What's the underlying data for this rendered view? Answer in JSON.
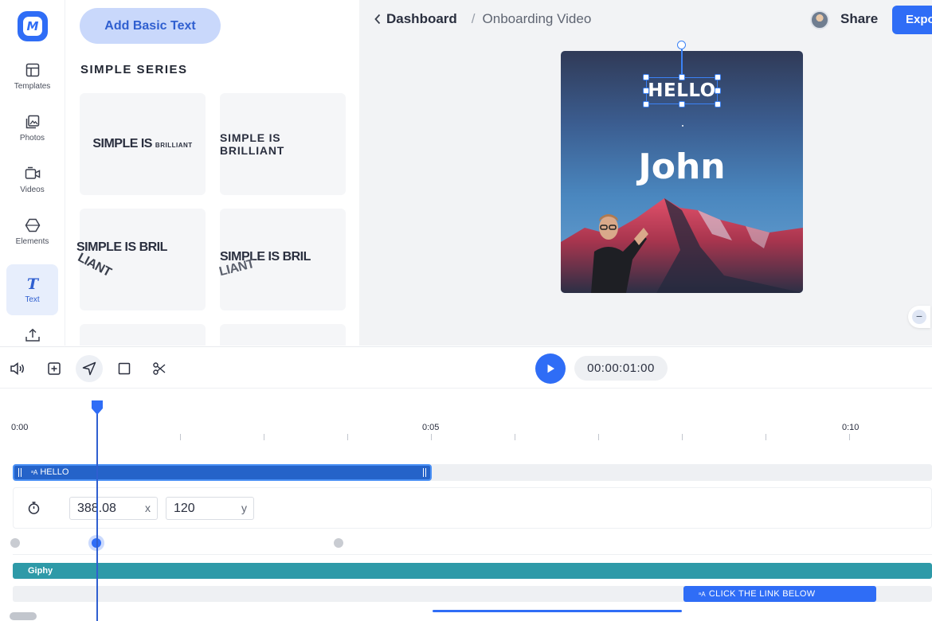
{
  "brand": {
    "logo_letter": "M",
    "accent": "#2f6df6"
  },
  "sidebar": {
    "items": [
      {
        "label": "Templates",
        "icon": "templates-icon"
      },
      {
        "label": "Photos",
        "icon": "photos-icon"
      },
      {
        "label": "Videos",
        "icon": "videos-icon"
      },
      {
        "label": "Elements",
        "icon": "elements-icon"
      },
      {
        "label": "Text",
        "icon": "text-icon",
        "active": true
      },
      {
        "label": "",
        "icon": "upload-icon"
      }
    ]
  },
  "panel": {
    "add_button": "Add Basic Text",
    "section_title": "SIMPLE SERIES",
    "presets": [
      {
        "line1": "SIMPLE IS",
        "line2": "BRILLIANT"
      },
      {
        "text": "SIMPLE IS BRILLIANT"
      },
      {
        "line1": "SIMPLE IS BRIL",
        "line2": "LIANT"
      },
      {
        "line1": "SIMPLE IS BRIL",
        "line2": "LIANT"
      }
    ]
  },
  "header": {
    "back_label": "Dashboard",
    "separator": "/",
    "project_title": "Onboarding Video",
    "share_label": "Share",
    "export_label": "Expo"
  },
  "canvas": {
    "selected_text": "HELLO",
    "headline": "John"
  },
  "toolbar": {
    "timecode": "00:00:01:00"
  },
  "timeline": {
    "tick_labels": [
      "0:00",
      "0:05",
      "0:10"
    ],
    "clips": {
      "hello": "HELLO",
      "giphy": "Giphy",
      "click": "CLICK THE LINK BELOW"
    },
    "position": {
      "x": "388.08",
      "x_axis": "x",
      "y": "120",
      "y_axis": "y"
    },
    "playhead_seconds": 1
  }
}
